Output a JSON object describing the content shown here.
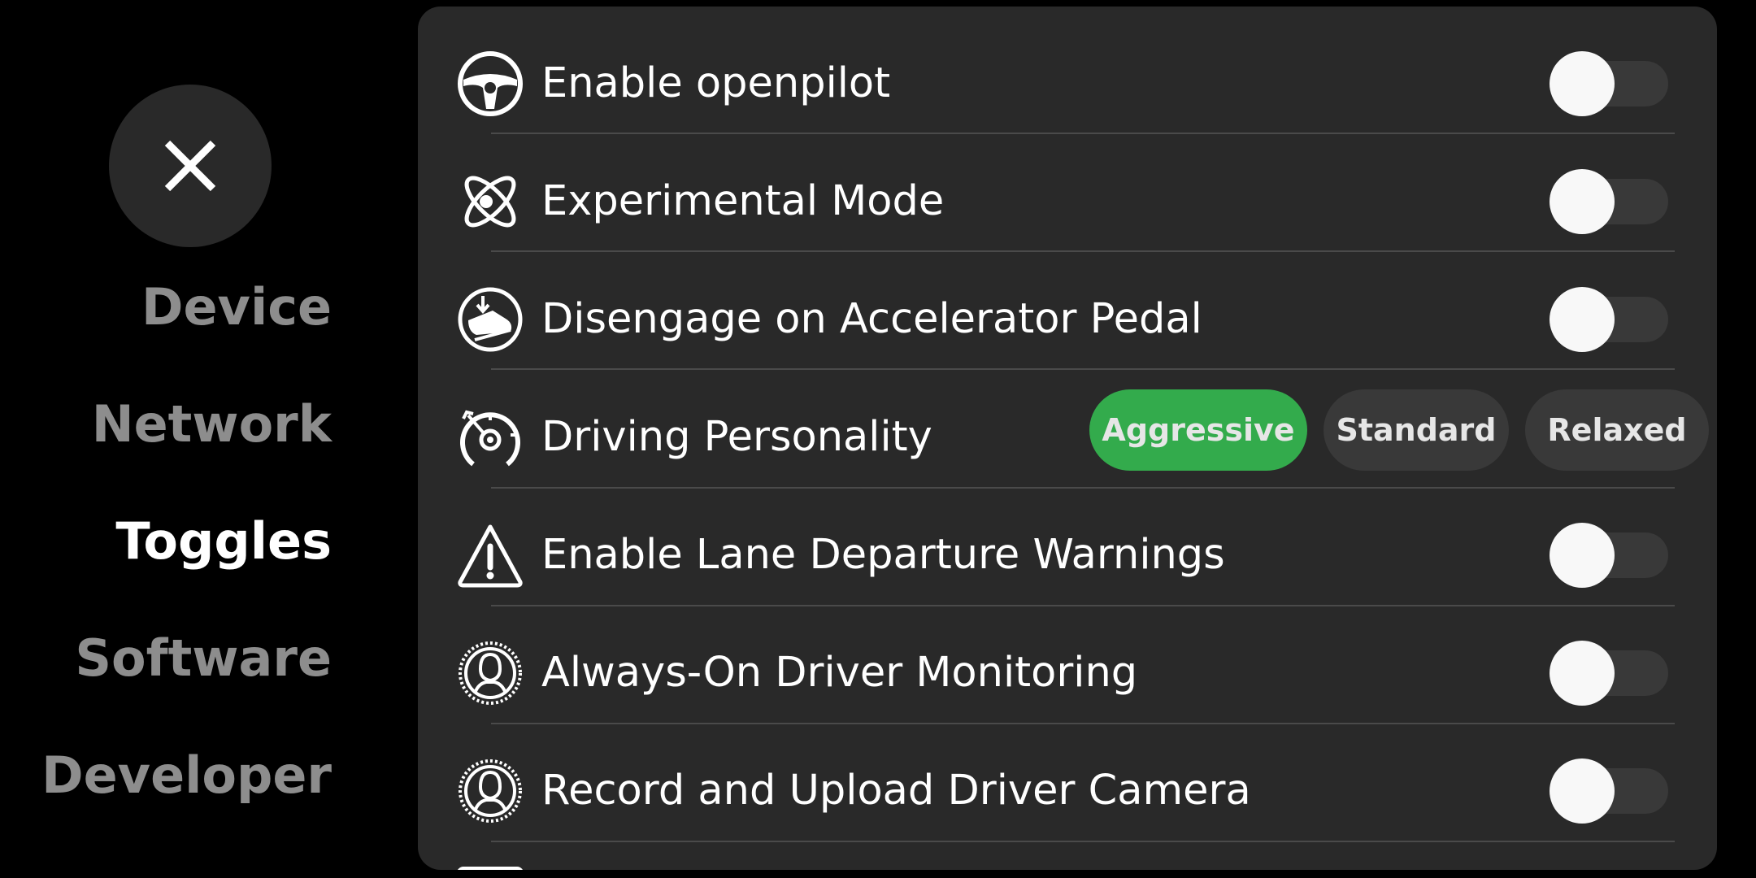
{
  "sidebar": {
    "close_icon": "close-x-icon",
    "items": [
      {
        "label": "Device",
        "active": false
      },
      {
        "label": "Network",
        "active": false
      },
      {
        "label": "Toggles",
        "active": true
      },
      {
        "label": "Software",
        "active": false
      },
      {
        "label": "Developer",
        "active": false
      }
    ]
  },
  "toggles": {
    "rows": [
      {
        "label": "Enable openpilot",
        "icon": "steering-wheel-icon",
        "state": "off"
      },
      {
        "label": "Experimental Mode",
        "icon": "atom-icon",
        "state": "off"
      },
      {
        "label": "Disengage on Accelerator Pedal",
        "icon": "accelerator-pedal-icon",
        "state": "off"
      },
      {
        "label": "Driving Personality",
        "icon": "speedometer-icon",
        "options": [
          "Aggressive",
          "Standard",
          "Relaxed"
        ],
        "selected": "Aggressive"
      },
      {
        "label": "Enable Lane Departure Warnings",
        "icon": "warning-triangle-icon",
        "state": "off"
      },
      {
        "label": "Always-On Driver Monitoring",
        "icon": "driver-monitoring-icon",
        "state": "off"
      },
      {
        "label": "Record and Upload Driver Camera",
        "icon": "driver-camera-icon",
        "state": "off"
      }
    ]
  },
  "colors": {
    "background": "#000000",
    "panel": "#292929",
    "selected_option": "#33ab4c",
    "inactive_nav": "#8d8d8d",
    "active_nav": "#ffffff"
  }
}
